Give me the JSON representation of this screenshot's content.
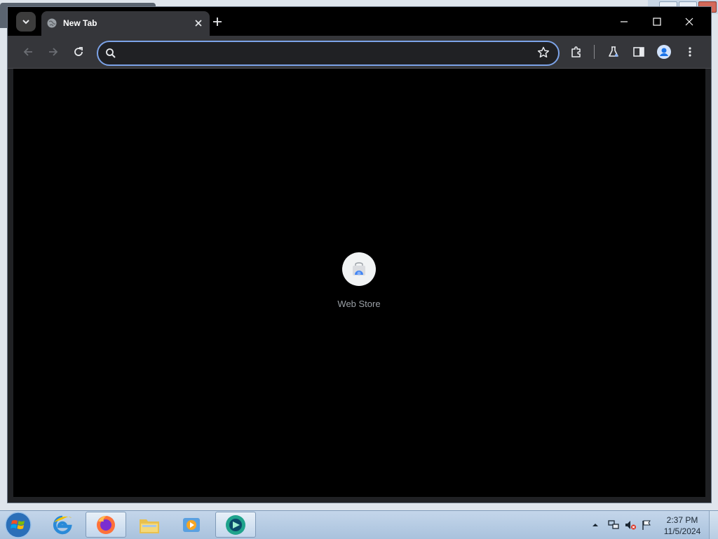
{
  "browser": {
    "tab": {
      "title": "New Tab"
    },
    "omnibox": {
      "value": "",
      "placeholder": ""
    },
    "accent": "#7ca3e8"
  },
  "new_tab_page": {
    "shortcuts": [
      {
        "label": "Web Store",
        "icon": "web-store-icon"
      }
    ]
  },
  "taskbar": {
    "items": [
      {
        "name": "internet-explorer",
        "icon": "ie-icon"
      },
      {
        "name": "firefox",
        "icon": "firefox-icon"
      },
      {
        "name": "file-explorer",
        "icon": "folder-icon"
      },
      {
        "name": "media-player",
        "icon": "media-player-icon"
      },
      {
        "name": "chrome",
        "icon": "browser-icon"
      }
    ],
    "clock": {
      "time": "2:37 PM",
      "date": "11/5/2024"
    }
  }
}
